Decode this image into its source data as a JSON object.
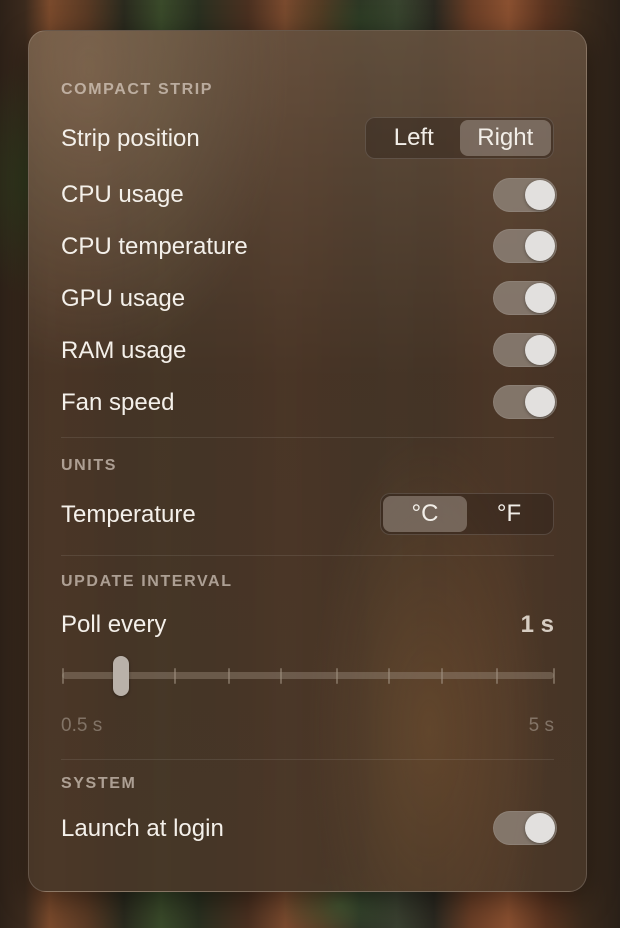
{
  "sections": {
    "compact_strip": {
      "header": "COMPACT STRIP",
      "strip_position": {
        "label": "Strip position",
        "options": [
          "Left",
          "Right"
        ],
        "selected": "Right"
      },
      "toggles": [
        {
          "label": "CPU usage",
          "on": true
        },
        {
          "label": "CPU temperature",
          "on": true
        },
        {
          "label": "GPU usage",
          "on": true
        },
        {
          "label": "RAM usage",
          "on": true
        },
        {
          "label": "Fan speed",
          "on": true
        }
      ]
    },
    "units": {
      "header": "UNITS",
      "temperature": {
        "label": "Temperature",
        "options": [
          "°C",
          "°F"
        ],
        "selected": "°C"
      }
    },
    "update_interval": {
      "header": "UPDATE INTERVAL",
      "poll": {
        "label": "Poll every",
        "value": "1 s",
        "min_label": "0.5 s",
        "max_label": "5 s",
        "steps": 10,
        "selected_step": 1
      }
    },
    "system": {
      "header": "SYSTEM",
      "launch_at_login": {
        "label": "Launch at login",
        "on": true
      }
    }
  },
  "colors": {
    "toggle_on": "#8c8076",
    "knob": "#e2e0de",
    "panel": "#54402f"
  }
}
